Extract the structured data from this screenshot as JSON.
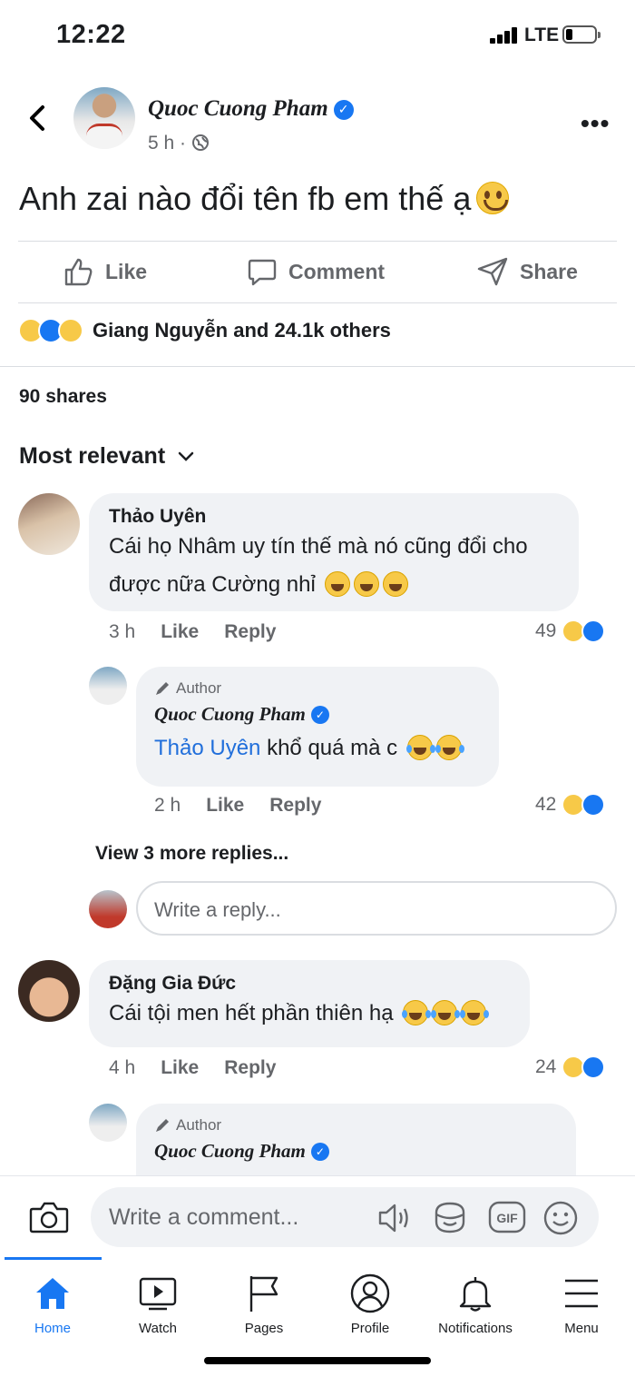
{
  "status_bar": {
    "time": "12:22",
    "network": "LTE"
  },
  "post": {
    "author": "Quoc Cuong Pham",
    "time": "5 h",
    "text": "Anh zai nào đổi tên fb em thế ạ",
    "actions": {
      "like": "Like",
      "comment": "Comment",
      "share": "Share"
    },
    "reactions_summary": "Giang Nguyễn and 24.1k others",
    "shares": "90 shares",
    "sort_label": "Most relevant"
  },
  "comments": [
    {
      "name": "Thảo Uyên",
      "text_line1": "Cái họ Nhâm uy tín thế mà nó cũng đổi cho",
      "text_line2": "được nữa Cường nhỉ",
      "time": "3 h",
      "like": "Like",
      "reply": "Reply",
      "count": "49",
      "reply_item": {
        "tag": "Author",
        "name": "Quoc Cuong Pham",
        "mention": "Thảo Uyên",
        "text": "khổ quá mà c",
        "time": "2 h",
        "like": "Like",
        "reply": "Reply",
        "count": "42"
      },
      "view_more": "View 3 more replies...",
      "reply_placeholder": "Write a reply..."
    },
    {
      "name": "Đặng Gia Đức",
      "text": "Cái tội men hết phần thiên hạ",
      "time": "4 h",
      "like": "Like",
      "reply": "Reply",
      "count": "24",
      "reply_item": {
        "tag": "Author",
        "name": "Quoc Cuong Pham"
      }
    }
  ],
  "composer": {
    "placeholder": "Write a comment..."
  },
  "tabs": [
    {
      "label": "Home",
      "icon": "home-icon",
      "active": true
    },
    {
      "label": "Watch",
      "icon": "watch-icon"
    },
    {
      "label": "Pages",
      "icon": "flag-icon"
    },
    {
      "label": "Profile",
      "icon": "profile-icon"
    },
    {
      "label": "Notifications",
      "icon": "bell-icon"
    },
    {
      "label": "Menu",
      "icon": "menu-icon"
    }
  ],
  "colors": {
    "accent": "#1877f2",
    "muted": "#65676b",
    "bubble": "#f0f2f5"
  }
}
